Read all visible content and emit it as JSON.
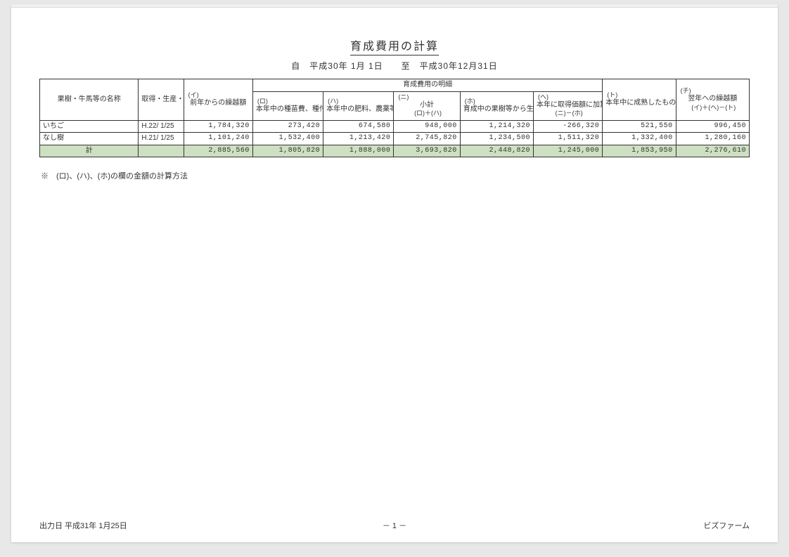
{
  "title": "育成費用の計算",
  "period": "自　平成30年  1月  1日　　至　平成30年12月31日",
  "headers": {
    "name": "果樹・牛馬等の名称",
    "date": "取得・生産・定植等の年月日",
    "carry": "前年からの繰越額",
    "detail_group": "育成費用の明細",
    "ro": "本年中の種苗費、種付料、素畜費",
    "ha": "本年中の肥料、農薬等の投下費用",
    "ni": "小計",
    "ni_sub": "(ロ)＋(ハ)",
    "ho": "育成中の果樹等から生じた収入金額",
    "he": "本年に取得価額に加算する金額",
    "he_sub": "(ニ)－(ホ)",
    "to": "本年中に成熟したものの取得価額",
    "chi": "翌年への繰越額",
    "chi_sub": "(イ)＋(ヘ)－(ト)",
    "mark_i": "(イ)",
    "mark_ro": "(ロ)",
    "mark_ha": "(ハ)",
    "mark_ni": "(ニ)",
    "mark_ho": "(ホ)",
    "mark_he": "(ヘ)",
    "mark_to": "(ト)",
    "mark_chi": "(チ)"
  },
  "rows": [
    {
      "name": "いちご",
      "date": "H.22/  1/25",
      "i": "1,784,320",
      "ro": "273,420",
      "ha": "674,580",
      "ni": "948,000",
      "ho": "1,214,320",
      "he": "-266,320",
      "to": "521,550",
      "chi": "996,450"
    },
    {
      "name": "なし樹",
      "date": "H.21/  1/25",
      "i": "1,101,240",
      "ro": "1,532,400",
      "ha": "1,213,420",
      "ni": "2,745,820",
      "ho": "1,234,500",
      "he": "1,511,320",
      "to": "1,332,400",
      "chi": "1,280,160"
    }
  ],
  "totals": {
    "label": "計",
    "i": "2,885,560",
    "ro": "1,805,820",
    "ha": "1,888,000",
    "ni": "3,693,820",
    "ho": "2,448,820",
    "he": "1,245,000",
    "to": "1,853,950",
    "chi": "2,276,610"
  },
  "note": "※　(ロ)、(ハ)、(ホ)の欄の金額の計算方法",
  "footer": {
    "left": "出力日 平成31年  1月25日",
    "center": "－  1  －",
    "right": "ビズファーム"
  }
}
